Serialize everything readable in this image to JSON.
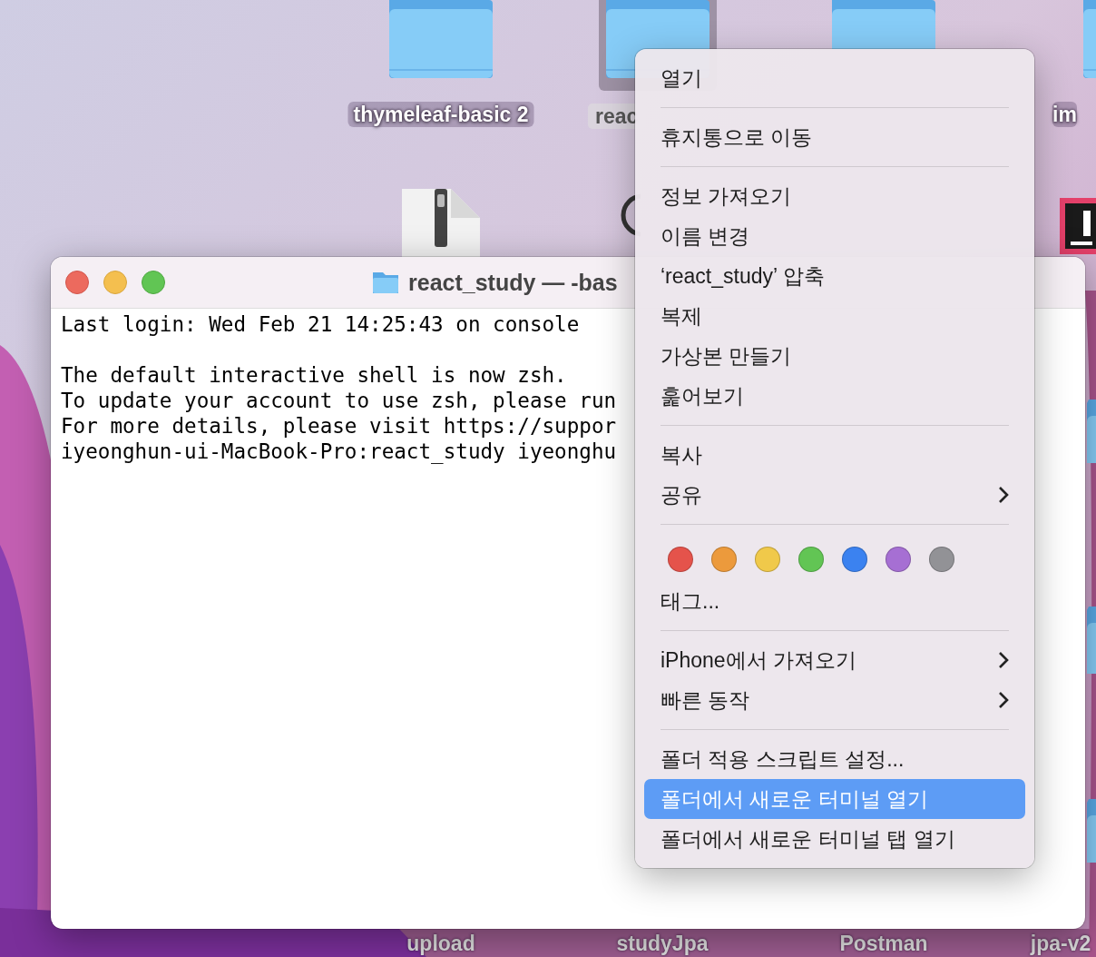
{
  "desktop": {
    "icons": [
      {
        "kind": "folder",
        "label": "thymeleaf-basic 2",
        "selected": false
      },
      {
        "kind": "folder",
        "label": "reac",
        "selected": true
      },
      {
        "kind": "folder",
        "selected": false
      },
      {
        "kind": "folder",
        "label": "im",
        "selected": false
      },
      {
        "kind": "zip",
        "selected": false
      },
      {
        "kind": "app",
        "selected": false
      },
      {
        "kind": "ide",
        "selected": false
      },
      {
        "kind": "folder",
        "selected": false
      },
      {
        "kind": "folder",
        "selected": false
      },
      {
        "kind": "folder",
        "selected": false
      },
      {
        "kind": "folder",
        "label": "upload",
        "selected": false
      },
      {
        "kind": "folder",
        "label": "studyJpa",
        "selected": false
      },
      {
        "kind": "folder",
        "label": "Postman",
        "selected": false
      },
      {
        "kind": "folder",
        "label": "jpa-v2",
        "selected": false
      }
    ]
  },
  "terminal": {
    "title": "react_study — -bas",
    "paragraphs": [
      [
        "Last login: Wed Feb 21 14:25:43 on console"
      ],
      [
        "The default interactive shell is now zsh.",
        "To update your account to use zsh, please run",
        "For more details, please visit https://suppor",
        "iyeonghun-ui-MacBook-Pro:react_study iyeonghu"
      ]
    ]
  },
  "context_menu": {
    "sections": [
      {
        "items": [
          {
            "label": "열기",
            "selected": false,
            "submenu": false
          }
        ]
      },
      {
        "items": [
          {
            "label": "휴지통으로 이동",
            "selected": false,
            "submenu": false
          }
        ]
      },
      {
        "items": [
          {
            "label": "정보 가져오기",
            "selected": false,
            "submenu": false
          },
          {
            "label": "이름 변경",
            "selected": false,
            "submenu": false
          },
          {
            "label": "‘react_study’ 압축",
            "selected": false,
            "submenu": false
          },
          {
            "label": "복제",
            "selected": false,
            "submenu": false
          },
          {
            "label": "가상본 만들기",
            "selected": false,
            "submenu": false
          },
          {
            "label": "훑어보기",
            "selected": false,
            "submenu": false
          }
        ]
      },
      {
        "items": [
          {
            "label": "복사",
            "selected": false,
            "submenu": false
          },
          {
            "label": "공유",
            "selected": false,
            "submenu": true
          }
        ]
      },
      {
        "tag_colors": [
          {
            "color": "#e5534b"
          },
          {
            "color": "#ec9a3c"
          },
          {
            "color": "#f0c94a"
          },
          {
            "color": "#62c554"
          },
          {
            "color": "#3b82f0"
          },
          {
            "color": "#a66fd3"
          },
          {
            "color": "#929296"
          }
        ],
        "items": [
          {
            "label": "태그...",
            "selected": false,
            "submenu": false
          }
        ]
      },
      {
        "items": [
          {
            "label": "iPhone에서 가져오기",
            "selected": false,
            "submenu": true
          },
          {
            "label": "빠른 동작",
            "selected": false,
            "submenu": true
          }
        ]
      },
      {
        "items": [
          {
            "label": "폴더 적용 스크립트 설정...",
            "selected": false,
            "submenu": false
          },
          {
            "label": "폴더에서 새로운 터미널 열기",
            "selected": true,
            "submenu": false
          },
          {
            "label": "폴더에서 새로운 터미널 탭 열기",
            "selected": false,
            "submenu": false
          }
        ]
      }
    ]
  }
}
